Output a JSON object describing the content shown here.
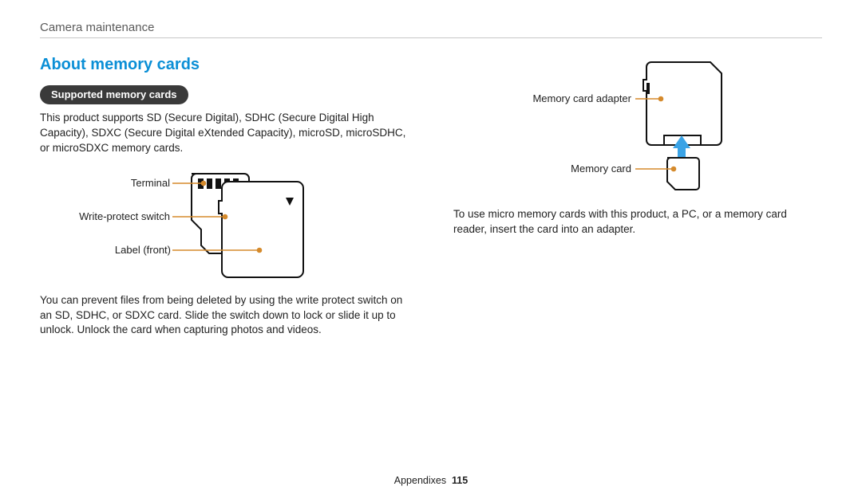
{
  "header": {
    "breadcrumb": "Camera maintenance"
  },
  "left": {
    "heading": "About memory cards",
    "subheading": "Supported memory cards",
    "intro": "This product supports SD (Secure Digital), SDHC (Secure Digital High Capacity), SDXC (Secure Digital eXtended Capacity), microSD, microSDHC, or microSDXC memory cards.",
    "fig_labels": {
      "terminal": "Terminal",
      "write_protect": "Write-protect switch",
      "label_front": "Label (front)"
    },
    "note": "You can prevent files from being deleted by using the write protect switch on an SD, SDHC, or SDXC card. Slide the switch down to lock or slide it up to unlock. Unlock the card when capturing photos and videos."
  },
  "right": {
    "fig_labels": {
      "adapter": "Memory card adapter",
      "card": "Memory card"
    },
    "note": "To use micro memory cards with this product, a PC, or a memory card reader, insert the card into an adapter."
  },
  "footer": {
    "section": "Appendixes",
    "page": "115"
  },
  "colors": {
    "accent": "#0b8fd6",
    "callout": "#d58a2c",
    "arrow": "#3aa3e6"
  }
}
